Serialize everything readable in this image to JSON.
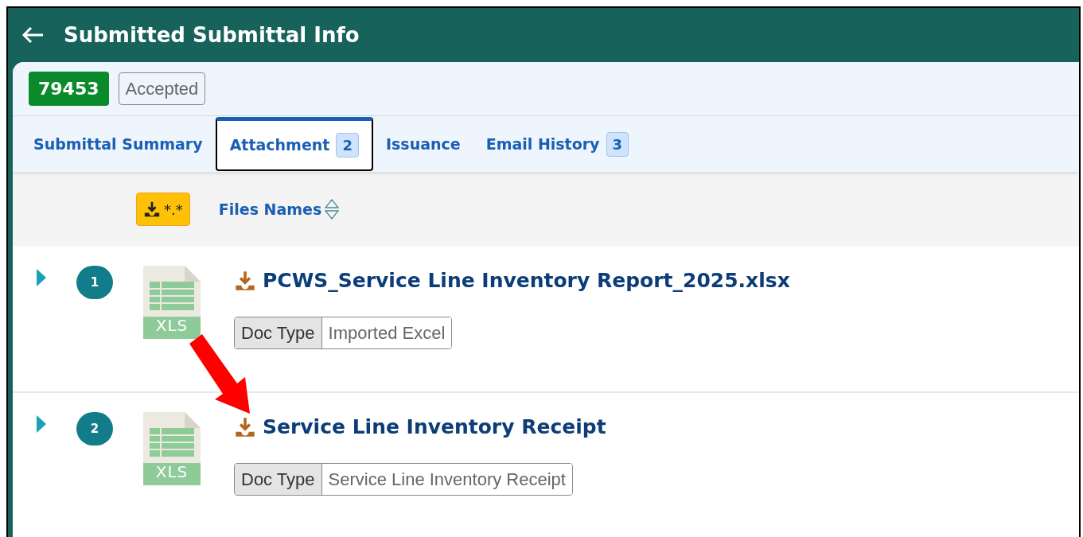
{
  "header": {
    "title": "Submitted Submittal Info"
  },
  "badges": [
    {
      "kind": "id",
      "text": "79453"
    },
    {
      "kind": "status",
      "text": "Accepted"
    }
  ],
  "tabs": [
    {
      "label": "Submittal Summary",
      "selected": false
    },
    {
      "label": "Attachment",
      "count": "2",
      "selected": true
    },
    {
      "label": "Issuance",
      "selected": false
    },
    {
      "label": "Email History",
      "count": "3",
      "selected": false
    }
  ],
  "table": {
    "download_all_label": "*.*",
    "column": "Files Names",
    "rows": [
      {
        "number": "1",
        "expanded": false,
        "file_type": "XLS",
        "name": "PCWS_Service Line Inventory Report_2025.xlsx",
        "doc_type_label": "Doc Type",
        "doc_type": "Imported Excel"
      },
      {
        "number": "2",
        "expanded": false,
        "file_type": "XLS",
        "name": "Service Line Inventory Receipt",
        "doc_type_label": "Doc Type",
        "doc_type": "Service Line Inventory Receipt"
      }
    ]
  },
  "annotations": [
    {
      "kind": "arrow"
    }
  ]
}
